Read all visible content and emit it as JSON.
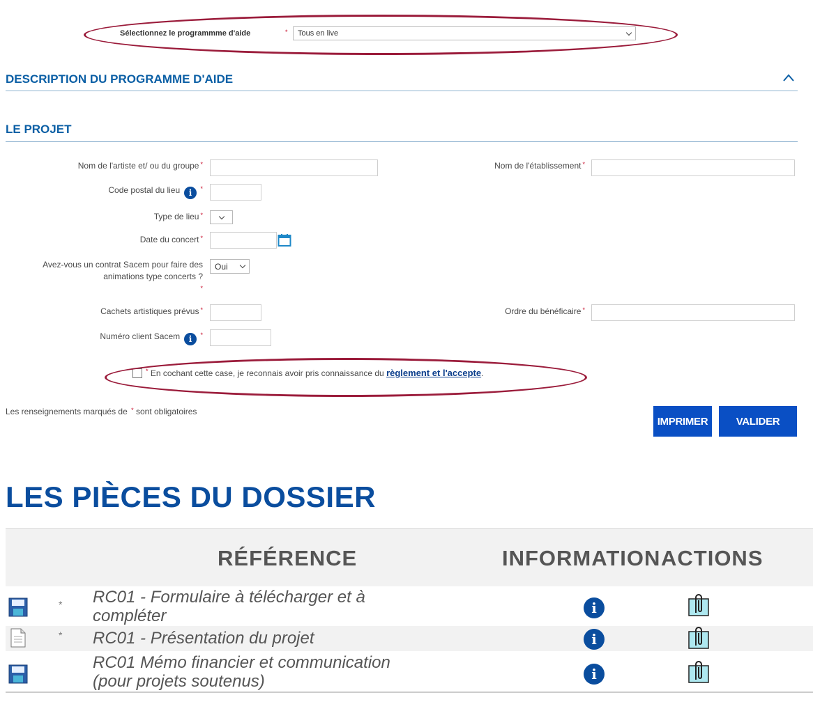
{
  "program_select": {
    "label": "Sélectionnez le programmme d'aide",
    "required": "*",
    "value": "Tous en live"
  },
  "sections": {
    "description_title": "DESCRIPTION DU PROGRAMME D'AIDE",
    "project_title": "LE PROJET"
  },
  "form": {
    "artist_label": "Nom de l'artiste et/ ou du groupe",
    "establishment_label": "Nom de l'établissement",
    "postal_label": "Code postal du lieu",
    "venue_type_label": "Type de lieu",
    "concert_date_label": "Date du concert",
    "contract_label_line1": "Avez-vous un contrat Sacem pour faire des",
    "contract_label_line2": "animations type concerts ?",
    "contract_value": "Oui",
    "fees_label": "Cachets artistiques prévus",
    "beneficiary_label": "Ordre du bénéficaire",
    "client_label": "Numéro client Sacem",
    "required_mark": "*"
  },
  "consent": {
    "text": "En cochant cette case, je reconnais avoir pris connaissance du",
    "link": "règlement et l'accepte",
    "period": "."
  },
  "footer_note": {
    "before": "Les renseignements marqués de",
    "after": "sont obligatoires"
  },
  "buttons": {
    "print": "IMPRIMER",
    "submit": "VALIDER"
  },
  "pieces": {
    "title": "LES PIÈCES DU DOSSIER",
    "col_reference": "RÉFÉRENCE",
    "col_information": "INFORMATION",
    "col_actions": "ACTIONS",
    "rows": [
      {
        "line1": "RC01 - Formulaire à télécharger et à",
        "line2": "compléter",
        "required": "*",
        "icon": "floppy-disk-icon"
      },
      {
        "line1": "RC01 - Présentation du projet",
        "line2": "",
        "required": "*",
        "icon": "document-icon"
      },
      {
        "line1": "RC01 Mémo financier et communication",
        "line2": "(pour projets soutenus)",
        "required": "",
        "icon": "floppy-disk-icon"
      }
    ]
  },
  "colors": {
    "accent": "#0b5fa5",
    "button": "#0a4fc4",
    "required": "#c8102e",
    "highlight_oval": "#9b1c3b"
  }
}
